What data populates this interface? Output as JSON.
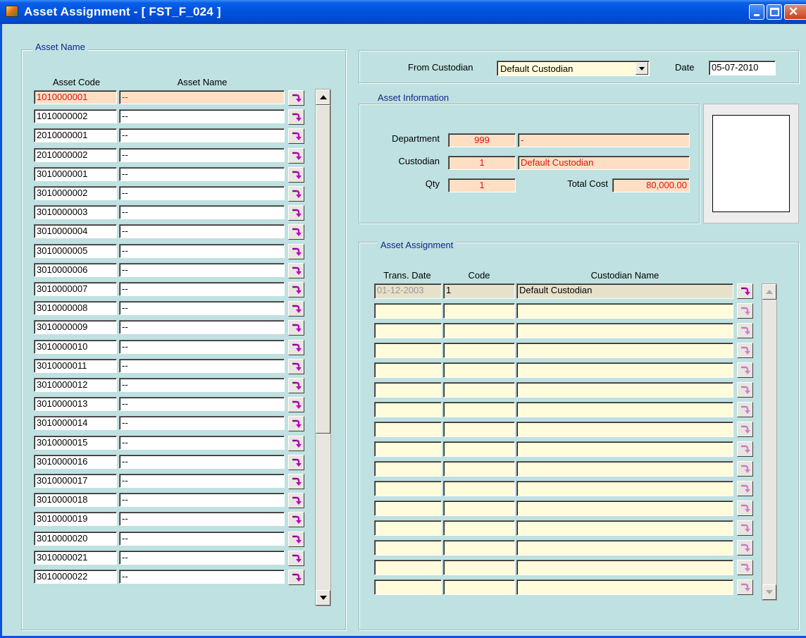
{
  "window": {
    "title": "Asset Assignment - [ FST_F_024 ]"
  },
  "asset_name_panel": {
    "title": "Asset Name",
    "col_code": "Asset Code",
    "col_name": "Asset Name",
    "rows": [
      {
        "code": "1010000001",
        "name": "--",
        "selected": true
      },
      {
        "code": "1010000002",
        "name": "--"
      },
      {
        "code": "2010000001",
        "name": "--"
      },
      {
        "code": "2010000002",
        "name": "--"
      },
      {
        "code": "3010000001",
        "name": "--"
      },
      {
        "code": "3010000002",
        "name": "--"
      },
      {
        "code": "3010000003",
        "name": "--"
      },
      {
        "code": "3010000004",
        "name": "--"
      },
      {
        "code": "3010000005",
        "name": "--"
      },
      {
        "code": "3010000006",
        "name": "--"
      },
      {
        "code": "3010000007",
        "name": "--"
      },
      {
        "code": "3010000008",
        "name": "--"
      },
      {
        "code": "3010000009",
        "name": "--"
      },
      {
        "code": "3010000010",
        "name": "--"
      },
      {
        "code": "3010000011",
        "name": "--"
      },
      {
        "code": "3010000012",
        "name": "--"
      },
      {
        "code": "3010000013",
        "name": "--"
      },
      {
        "code": "3010000014",
        "name": "--"
      },
      {
        "code": "3010000015",
        "name": "--"
      },
      {
        "code": "3010000016",
        "name": "--"
      },
      {
        "code": "3010000017",
        "name": "--"
      },
      {
        "code": "3010000018",
        "name": "--"
      },
      {
        "code": "3010000019",
        "name": "--"
      },
      {
        "code": "3010000020",
        "name": "--"
      },
      {
        "code": "3010000021",
        "name": "--"
      },
      {
        "code": "3010000022",
        "name": "--"
      }
    ]
  },
  "header": {
    "from_custodian_label": "From Custodian",
    "from_custodian_value": "Default Custodian",
    "date_label": "Date",
    "date_value": "05-07-2010"
  },
  "asset_info": {
    "title": "Asset Information",
    "department_label": "Department",
    "department_code": "999",
    "department_name": "-",
    "custodian_label": "Custodian",
    "custodian_code": "1",
    "custodian_name": "Default Custodian",
    "qty_label": "Qty",
    "qty_value": "1",
    "total_cost_label": "Total Cost",
    "total_cost_value": "80,000.00"
  },
  "assignment": {
    "title": "Asset Assignment",
    "col_date": "Trans. Date",
    "col_code": "Code",
    "col_name": "Custodian Name",
    "rows": [
      {
        "date": "01-12-2003",
        "code": "1",
        "name": "Default Custodian"
      },
      {
        "date": "",
        "code": "",
        "name": ""
      },
      {
        "date": "",
        "code": "",
        "name": ""
      },
      {
        "date": "",
        "code": "",
        "name": ""
      },
      {
        "date": "",
        "code": "",
        "name": ""
      },
      {
        "date": "",
        "code": "",
        "name": ""
      },
      {
        "date": "",
        "code": "",
        "name": ""
      },
      {
        "date": "",
        "code": "",
        "name": ""
      },
      {
        "date": "",
        "code": "",
        "name": ""
      },
      {
        "date": "",
        "code": "",
        "name": ""
      },
      {
        "date": "",
        "code": "",
        "name": ""
      },
      {
        "date": "",
        "code": "",
        "name": ""
      },
      {
        "date": "",
        "code": "",
        "name": ""
      },
      {
        "date": "",
        "code": "",
        "name": ""
      },
      {
        "date": "",
        "code": "",
        "name": ""
      },
      {
        "date": "",
        "code": "",
        "name": ""
      }
    ]
  },
  "icons": {
    "row_action": "select-arrow-icon",
    "scroll_up": "triangle-up-icon",
    "scroll_down": "triangle-down-icon"
  },
  "colors": {
    "form_bg": "#BFE1E1",
    "titlebar": "#0052DE",
    "selected_field": "#FFDFC4",
    "readonly_field": "#FFDFC4",
    "empty_field": "#FFFBDB",
    "accent_text": "#E01010",
    "arrow_icon": "#C000C0"
  }
}
